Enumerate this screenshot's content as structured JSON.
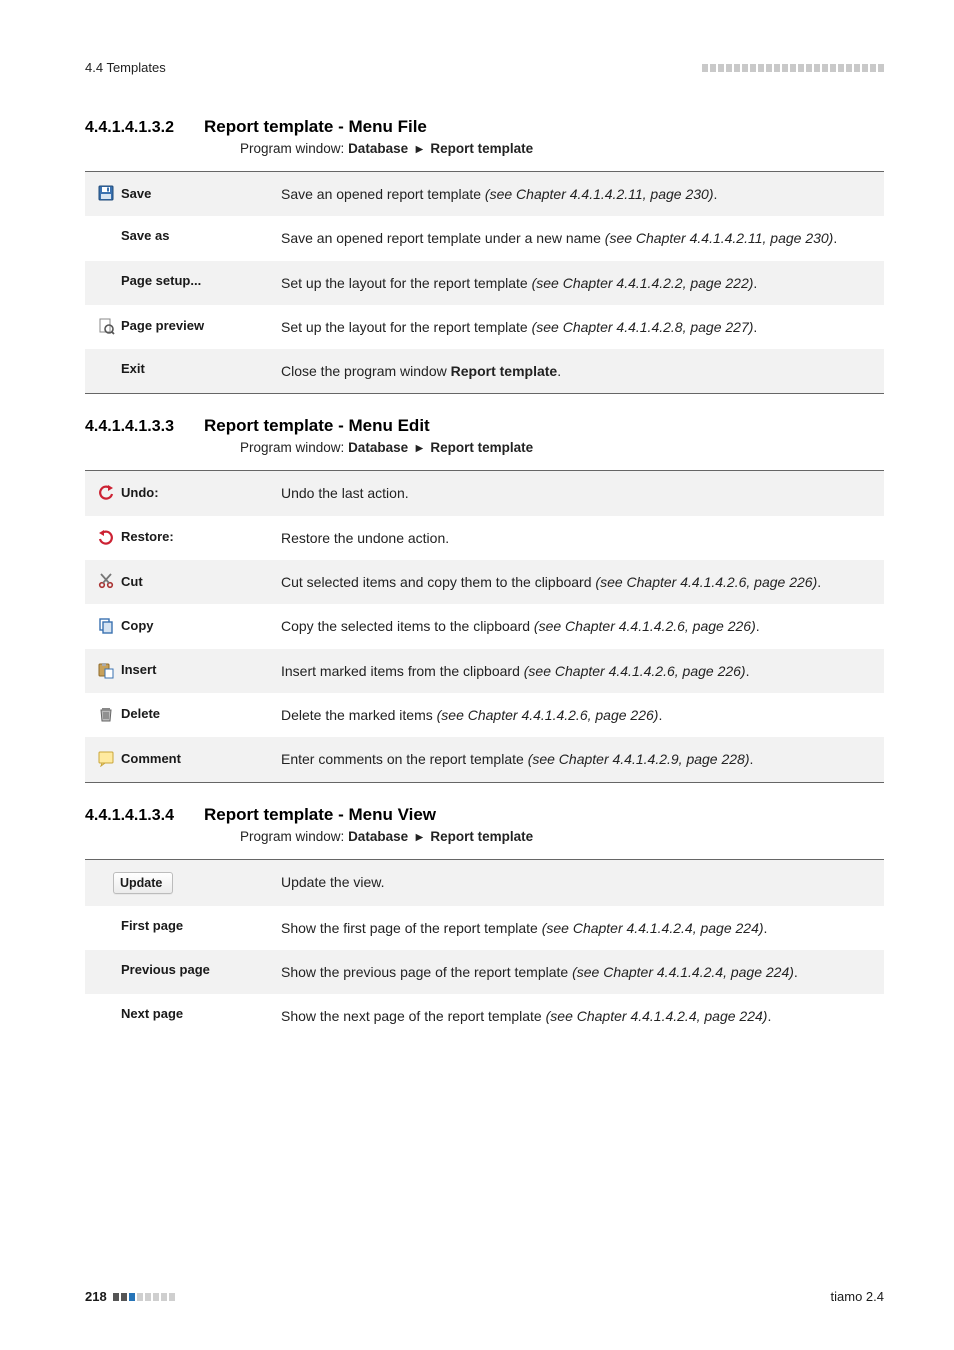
{
  "running_header": {
    "left": "4.4 Templates"
  },
  "sections": [
    {
      "number": "4.4.1.4.1.3.2",
      "title": "Report template - Menu File",
      "sub_prefix": "Program window:",
      "sub_path": [
        "Database",
        "Report template"
      ],
      "rows": [
        {
          "icon": "save-icon",
          "label": "Save",
          "shade": true,
          "desc_pre": "Save an opened report template ",
          "desc_italic": "(see Chapter 4.4.1.4.2.11, page 230)",
          "desc_post": "."
        },
        {
          "icon": null,
          "label": "Save as",
          "shade": false,
          "desc_pre": "Save an opened report template under a new name ",
          "desc_italic": "(see Chapter 4.4.1.4.2.11, page 230)",
          "desc_post": "."
        },
        {
          "icon": null,
          "label": "Page setup...",
          "shade": true,
          "desc_pre": "Set up the layout for the report template ",
          "desc_italic": "(see Chapter 4.4.1.4.2.2, page 222)",
          "desc_post": "."
        },
        {
          "icon": "preview-icon",
          "label": "Page preview",
          "shade": false,
          "desc_pre": "Set up the layout for the report template ",
          "desc_italic": "(see Chapter 4.4.1.4.2.8, page 227)",
          "desc_post": "."
        },
        {
          "icon": null,
          "label": "Exit",
          "shade": true,
          "desc_pre": "Close the program window ",
          "desc_bold": "Report template",
          "desc_post": "."
        }
      ]
    },
    {
      "number": "4.4.1.4.1.3.3",
      "title": "Report template - Menu Edit",
      "sub_prefix": "Program window:",
      "sub_path": [
        "Database",
        "Report template"
      ],
      "rows": [
        {
          "icon": "undo-icon",
          "label": "Undo:",
          "shade": true,
          "desc_pre": "Undo the last action."
        },
        {
          "icon": "redo-icon",
          "label": "Restore:",
          "shade": false,
          "desc_pre": "Restore the undone action."
        },
        {
          "icon": "cut-icon",
          "label": "Cut",
          "shade": true,
          "desc_pre": "Cut selected items and copy them to the clipboard ",
          "desc_italic": "(see Chapter 4.4.1.4.2.6, page 226)",
          "desc_post": "."
        },
        {
          "icon": "copy-icon",
          "label": "Copy",
          "shade": false,
          "desc_pre": "Copy the selected items to the clipboard ",
          "desc_italic": "(see Chapter 4.4.1.4.2.6, page 226)",
          "desc_post": "."
        },
        {
          "icon": "insert-icon",
          "label": "Insert",
          "shade": true,
          "desc_pre": "Insert marked items from the clipboard ",
          "desc_italic": "(see Chapter 4.4.1.4.2.6, page 226)",
          "desc_post": "."
        },
        {
          "icon": "delete-icon",
          "label": "Delete",
          "shade": false,
          "desc_pre": "Delete the marked items ",
          "desc_italic": "(see Chapter 4.4.1.4.2.6, page 226)",
          "desc_post": "."
        },
        {
          "icon": "comment-icon",
          "label": "Comment",
          "shade": true,
          "desc_pre": "Enter comments on the report template ",
          "desc_italic": "(see Chapter 4.4.1.4.2.9, page 228)",
          "desc_post": "."
        }
      ]
    },
    {
      "number": "4.4.1.4.1.3.4",
      "title": "Report template - Menu View",
      "sub_prefix": "Program window:",
      "sub_path": [
        "Database",
        "Report template"
      ],
      "rows": [
        {
          "button": true,
          "label": "Update",
          "shade": true,
          "desc_pre": "Update the view."
        },
        {
          "icon": null,
          "label": "First page",
          "shade": false,
          "desc_pre": "Show the first page of the report template ",
          "desc_italic": "(see Chapter 4.4.1.4.2.4, page 224)",
          "desc_post": "."
        },
        {
          "icon": null,
          "label": "Previous page",
          "shade": true,
          "desc_pre": "Show the previous page of the report template ",
          "desc_italic": "(see Chapter 4.4.1.4.2.4, page 224)",
          "desc_post": "."
        },
        {
          "icon": null,
          "label": "Next page",
          "shade": false,
          "desc_pre": "Show the next page of the report template ",
          "desc_italic": "(see Chapter 4.4.1.4.2.4, page 224)",
          "desc_post": "."
        }
      ]
    }
  ],
  "footer": {
    "page": "218",
    "software": "tiamo 2.4"
  },
  "colors": {
    "bar_light": "#cfcfcf",
    "bar_dark": "#555555",
    "bar_accent": "#2574b8"
  },
  "icons": {
    "save-icon": "save",
    "preview-icon": "preview",
    "undo-icon": "undo",
    "redo-icon": "redo",
    "cut-icon": "cut",
    "copy-icon": "copy",
    "insert-icon": "insert",
    "delete-icon": "delete",
    "comment-icon": "comment"
  }
}
